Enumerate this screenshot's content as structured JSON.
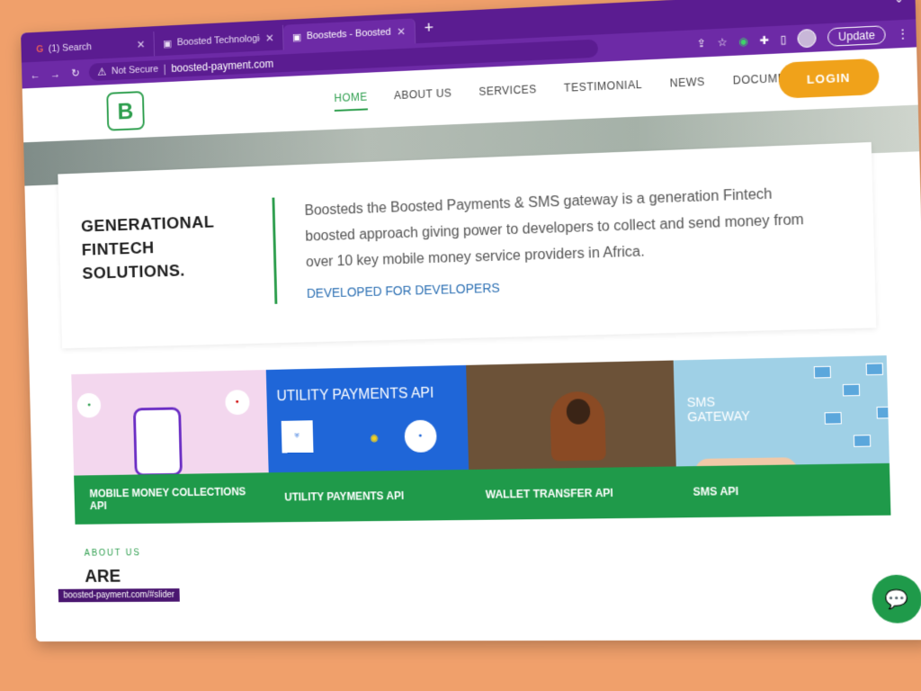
{
  "browser": {
    "tabs": [
      {
        "label": "(1) Search",
        "icon": "search-icon"
      },
      {
        "label": "Boosted Technologies - Inspiring",
        "icon": "site-icon"
      },
      {
        "label": "Boosteds - Boosted Payments",
        "icon": "site-icon"
      }
    ],
    "security_label": "Not Secure",
    "url": "boosted-payment.com",
    "update_label": "Update"
  },
  "site": {
    "logo_text": "B",
    "nav": [
      "HOME",
      "ABOUT US",
      "SERVICES",
      "TESTIMONIAL",
      "NEWS",
      "DOCUMENTATION"
    ],
    "login_label": "LOGIN"
  },
  "hero": {
    "tagline_line1": "GENERATIONAL",
    "tagline_line2": "FINTECH",
    "tagline_line3": "SOLUTIONS.",
    "description": "Boosteds the Boosted Payments & SMS gateway is a generation Fintech boosted approach giving power to developers to collect and send money from over 10 key mobile money service providers in Africa.",
    "cta": "DEVELOPED FOR DEVELOPERS"
  },
  "services": [
    {
      "title": "MOBILE MONEY COLLECTIONS API"
    },
    {
      "title": "UTILITY PAYMENTS API",
      "heading": "UTILITY PAYMENTS API"
    },
    {
      "title": "WALLET TRANSFER API"
    },
    {
      "title": "SMS API",
      "heading": "SMS GATEWAY"
    }
  ],
  "about": {
    "label": "ABOUT US",
    "heading_partial": "ARE"
  },
  "status_url": "boosted-payment.com/#slider",
  "colors": {
    "brand_green": "#2d9e4d",
    "login_orange": "#f0a21a",
    "browser_purple": "#5b1c91",
    "background": "#f0a06b"
  }
}
